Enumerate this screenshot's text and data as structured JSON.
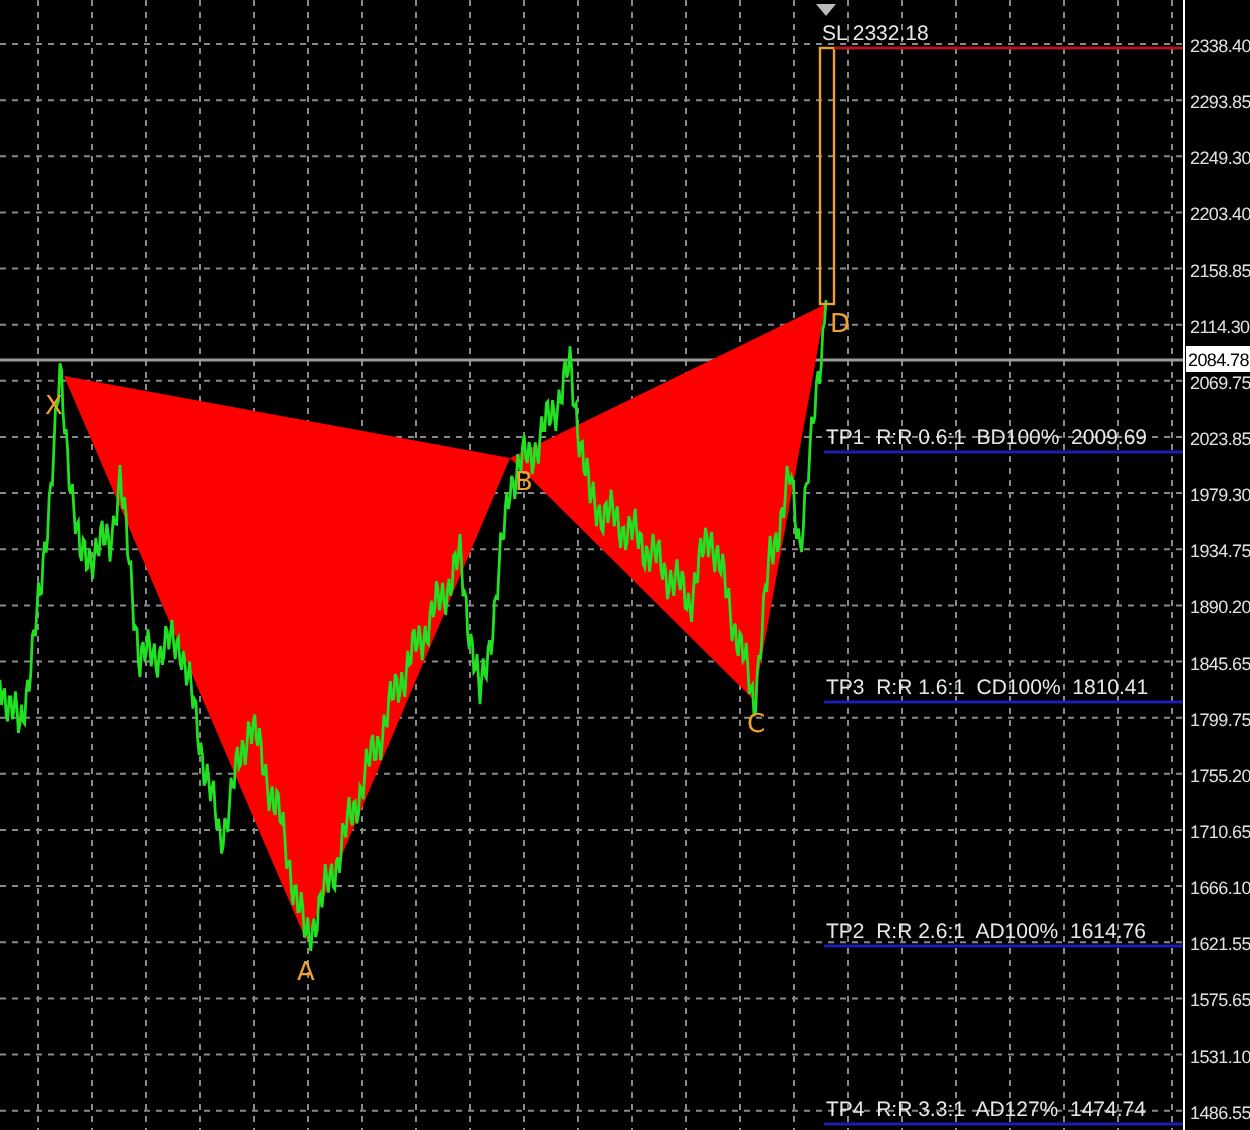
{
  "price_axis": {
    "labels": [
      "2338.40",
      "2293.85",
      "2249.30",
      "2203.40",
      "2158.85",
      "2114.30",
      "2069.75",
      "2023.85",
      "1979.30",
      "1934.75",
      "1890.20",
      "1845.65",
      "1799.75",
      "1755.20",
      "1710.65",
      "1666.10",
      "1621.55",
      "1575.65",
      "1531.10",
      "1486.55"
    ]
  },
  "current_price": "2084.78",
  "pattern": {
    "points": [
      {
        "label": "X"
      },
      {
        "label": "A"
      },
      {
        "label": "B"
      },
      {
        "label": "C"
      },
      {
        "label": "D"
      }
    ]
  },
  "stop_loss": {
    "label": "SL 2332.18"
  },
  "targets": [
    {
      "label": "TP1  R:R 0.6:1  BD100%  2009.69"
    },
    {
      "label": "TP3  R:R 1.6:1  CD100%  1810.41"
    },
    {
      "label": "TP2  R:R 2.6:1  AD100%  1614.76"
    },
    {
      "label": "TP4  R:R 3.3:1  AD127%  1474.74"
    }
  ]
}
